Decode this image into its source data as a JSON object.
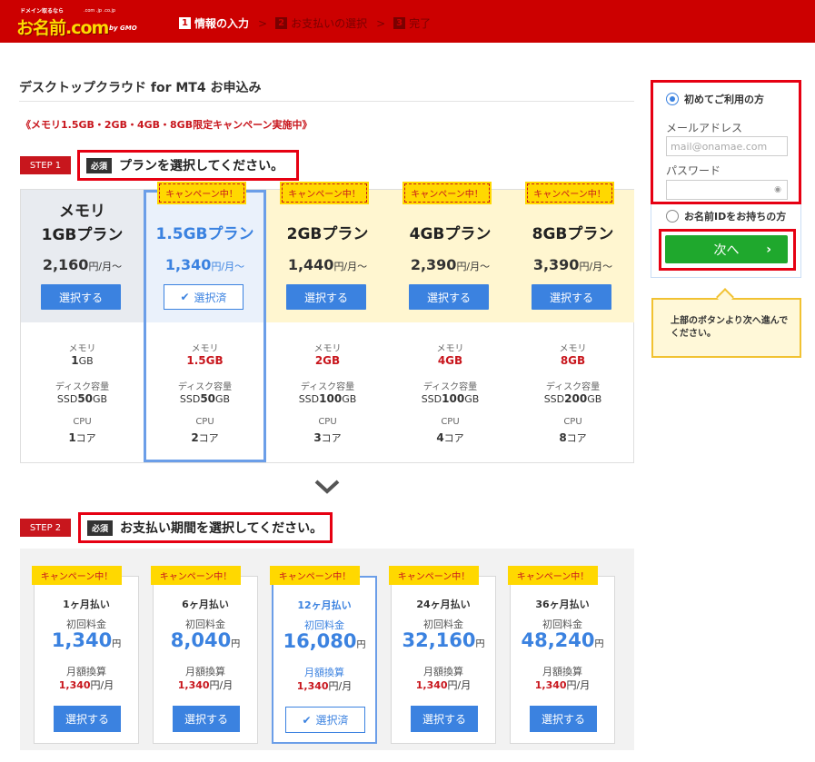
{
  "header": {
    "logo_small": "ドメイン取るなら",
    "logo_main": "お名前.com",
    "logo_tld": ".com .jp .co.jp",
    "logo_by": "by GMO",
    "steps": [
      {
        "num": "1",
        "label": "情報の入力"
      },
      {
        "num": "2",
        "label": "お支払いの選択"
      },
      {
        "num": "3",
        "label": "完了"
      }
    ]
  },
  "page": {
    "title": "デスクトップクラウド for MT4 お申込み",
    "campaign_note": "《メモリ1.5GB・2GB・4GB・8GB限定キャンペーン実施中》"
  },
  "step1": {
    "tag": "STEP 1",
    "required": "必須",
    "heading": "プランを選択してください。"
  },
  "campaign_label": "キャンペーン中！",
  "spec_labels": {
    "memory": "メモリ",
    "disk": "ディスク容量",
    "cpu": "CPU"
  },
  "plans": [
    {
      "name1": "メモリ",
      "name2": "1GBプラン",
      "price": "2,160",
      "unit": "円/月〜",
      "button": "選択する",
      "mem_num": "1",
      "mem_unit": "GB",
      "disk_pre": "SSD",
      "disk_num": "50",
      "disk_unit": "GB",
      "cpu_num": "1",
      "cpu_unit": "コア"
    },
    {
      "name1": "1.5GBプラン",
      "price": "1,340",
      "unit": "円/月〜",
      "button": "選択済",
      "mem_num": "1.5GB",
      "disk_pre": "SSD",
      "disk_num": "50",
      "disk_unit": "GB",
      "cpu_num": "2",
      "cpu_unit": "コア"
    },
    {
      "name1": "2GBプラン",
      "price": "1,440",
      "unit": "円/月〜",
      "button": "選択する",
      "mem_num": "2GB",
      "disk_pre": "SSD",
      "disk_num": "100",
      "disk_unit": "GB",
      "cpu_num": "3",
      "cpu_unit": "コア"
    },
    {
      "name1": "4GBプラン",
      "price": "2,390",
      "unit": "円/月〜",
      "button": "選択する",
      "mem_num": "4GB",
      "disk_pre": "SSD",
      "disk_num": "100",
      "disk_unit": "GB",
      "cpu_num": "4",
      "cpu_unit": "コア"
    },
    {
      "name1": "8GBプラン",
      "price": "3,390",
      "unit": "円/月〜",
      "button": "選択する",
      "mem_num": "8GB",
      "disk_pre": "SSD",
      "disk_num": "200",
      "disk_unit": "GB",
      "cpu_num": "8",
      "cpu_unit": "コア"
    }
  ],
  "step2": {
    "tag": "STEP 2",
    "required": "必須",
    "heading": "お支払い期間を選択してください。"
  },
  "payment_labels": {
    "first": "初回料金",
    "monthly": "月額換算",
    "yen": "円",
    "per_month": "円/月"
  },
  "payments": [
    {
      "period": "1ヶ月払い",
      "first": "1,340",
      "monthly": "1,340",
      "button": "選択する"
    },
    {
      "period": "6ヶ月払い",
      "first": "8,040",
      "monthly": "1,340",
      "button": "選択する"
    },
    {
      "period": "12ヶ月払い",
      "first": "16,080",
      "monthly": "1,340",
      "button": "選択済"
    },
    {
      "period": "24ヶ月払い",
      "first": "32,160",
      "monthly": "1,340",
      "button": "選択する"
    },
    {
      "period": "36ヶ月払い",
      "first": "48,240",
      "monthly": "1,340",
      "button": "選択する"
    }
  ],
  "sidebar": {
    "first_time": "初めてご利用の方",
    "email_label": "メールアドレス",
    "email_placeholder": "mail@onamae.com",
    "password_label": "パスワード",
    "existing": "お名前IDをお持ちの方",
    "next_button": "次へ",
    "next_arrow": "›",
    "hint": "上部のボタンより次へ進んでください。"
  },
  "colors": {
    "header_red": "#cc0000",
    "accent_blue": "#3b82e0",
    "campaign_yellow": "#ffd800",
    "next_green": "#1fa82d",
    "price_red": "#c8161d"
  }
}
